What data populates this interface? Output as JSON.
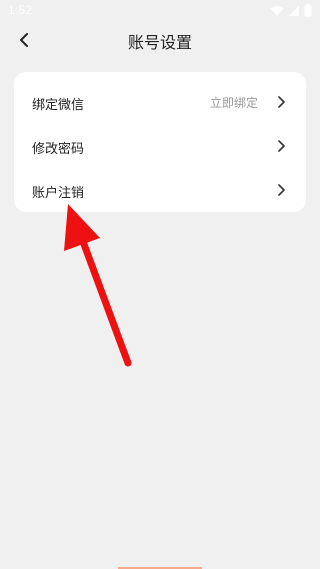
{
  "status_bar": {
    "time": "1:52",
    "icons": [
      "wifi-icon",
      "signal-icon",
      "battery-icon"
    ]
  },
  "header": {
    "title": "账号设置",
    "back_icon": "chevron-left-icon"
  },
  "settings": {
    "items": [
      {
        "label": "绑定微信",
        "value": "立即绑定",
        "icon": "chevron-right-icon"
      },
      {
        "label": "修改密码",
        "value": "",
        "icon": "chevron-right-icon"
      },
      {
        "label": "账户注销",
        "value": "",
        "icon": "chevron-right-icon"
      }
    ]
  },
  "colors": {
    "background": "#f0f0f0",
    "card": "#ffffff",
    "text_primary": "#222222",
    "text_secondary": "#999999",
    "annotation_arrow": "#ee1111"
  }
}
